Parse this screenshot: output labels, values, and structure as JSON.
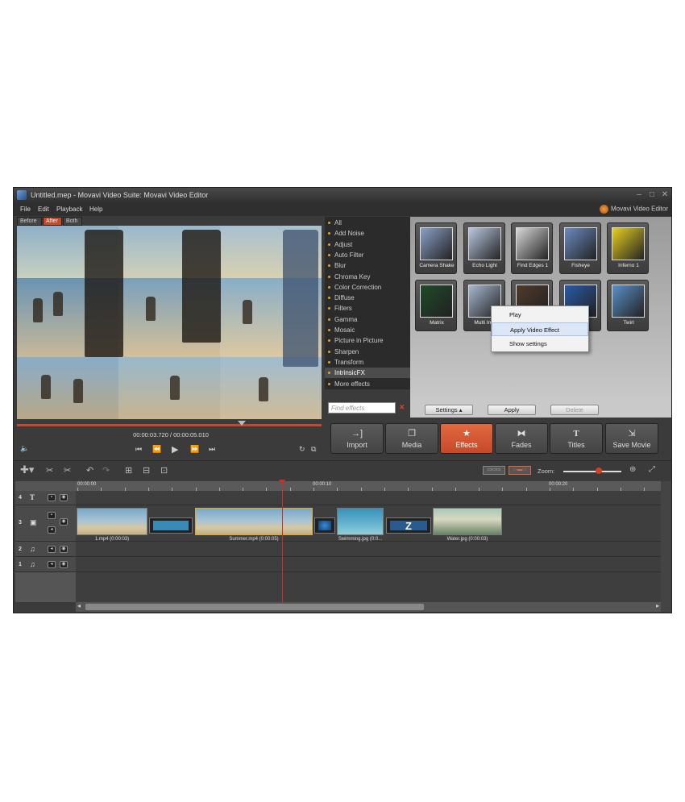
{
  "window": {
    "title": "Untitled.mep - Movavi Video Suite: Movavi Video Editor",
    "brand": "Movavi Video Editor",
    "controls": [
      "–",
      "□",
      "✕"
    ]
  },
  "menu": [
    "File",
    "Edit",
    "Playback",
    "Help"
  ],
  "preview_tabs": [
    {
      "label": "Before",
      "active": false
    },
    {
      "label": "After",
      "active": true
    },
    {
      "label": "Both",
      "active": false
    }
  ],
  "effects_categories": [
    "All",
    "Add Noise",
    "Adjust",
    "Auto Filter",
    "Blur",
    "Chroma Key",
    "Color Correction",
    "Diffuse",
    "Filters",
    "Gamma",
    "Mosaic",
    "Picture in Picture",
    "Sharpen",
    "Transform",
    "IntrinsicFX",
    "More effects"
  ],
  "selected_category": "IntrinsicFX",
  "find_placeholder": "Find effects",
  "effects": [
    {
      "label": "Camera Shake",
      "color": "#8aa0c8"
    },
    {
      "label": "Echo Light",
      "color": "#b8c8e0"
    },
    {
      "label": "Find Edges 1",
      "color": "#d8d8d8"
    },
    {
      "label": "Fisheye",
      "color": "#6a8ac0"
    },
    {
      "label": "Inferno 1",
      "color": "#e8d020"
    },
    {
      "label": "Matrix",
      "color": "#1f4a2a"
    },
    {
      "label": "Multi Ima",
      "color": "#a8b8d0"
    },
    {
      "label": "",
      "color": "#503a2a"
    },
    {
      "label": "",
      "color": "#2a5aa8"
    },
    {
      "label": "Twirl",
      "color": "#5a90c8"
    }
  ],
  "context_menu": [
    "Play",
    "Apply Video Effect",
    "Show settings"
  ],
  "context_hover": "Apply Video Effect",
  "fx_buttons": {
    "settings": "Settings",
    "apply": "Apply",
    "delete": "Delete"
  },
  "timecode": "00:00:03.720 / 00:00:05.010",
  "main_buttons": [
    {
      "label": "Import",
      "icon": "→]",
      "active": false
    },
    {
      "label": "Media",
      "icon": "❐",
      "active": false
    },
    {
      "label": "Effects",
      "icon": "★",
      "active": true
    },
    {
      "label": "Fades",
      "icon": "⧓",
      "active": false
    },
    {
      "label": "Titles",
      "icon": "T",
      "active": false
    },
    {
      "label": "Save Movie",
      "icon": "⇲",
      "active": false
    }
  ],
  "zoom_label": "Zoom:",
  "ruler": [
    "00:00:00",
    "00:00:10",
    "00:00:20"
  ],
  "tracks": [
    {
      "num": "4",
      "icon": "T"
    },
    {
      "num": "3",
      "icon": "▣"
    },
    {
      "num": "2",
      "icon": "♫"
    },
    {
      "num": "1",
      "icon": "♫"
    }
  ],
  "clips": [
    {
      "label": "1.mp4 (0:00:03)"
    },
    {
      "label": "Summer.mp4 (0:00:05)"
    },
    {
      "label": "Swimming.jpg (0:0..."
    },
    {
      "label": "Water.jpg (0:00:03)"
    }
  ],
  "transition_z": "Z",
  "accent": "#c8482a"
}
